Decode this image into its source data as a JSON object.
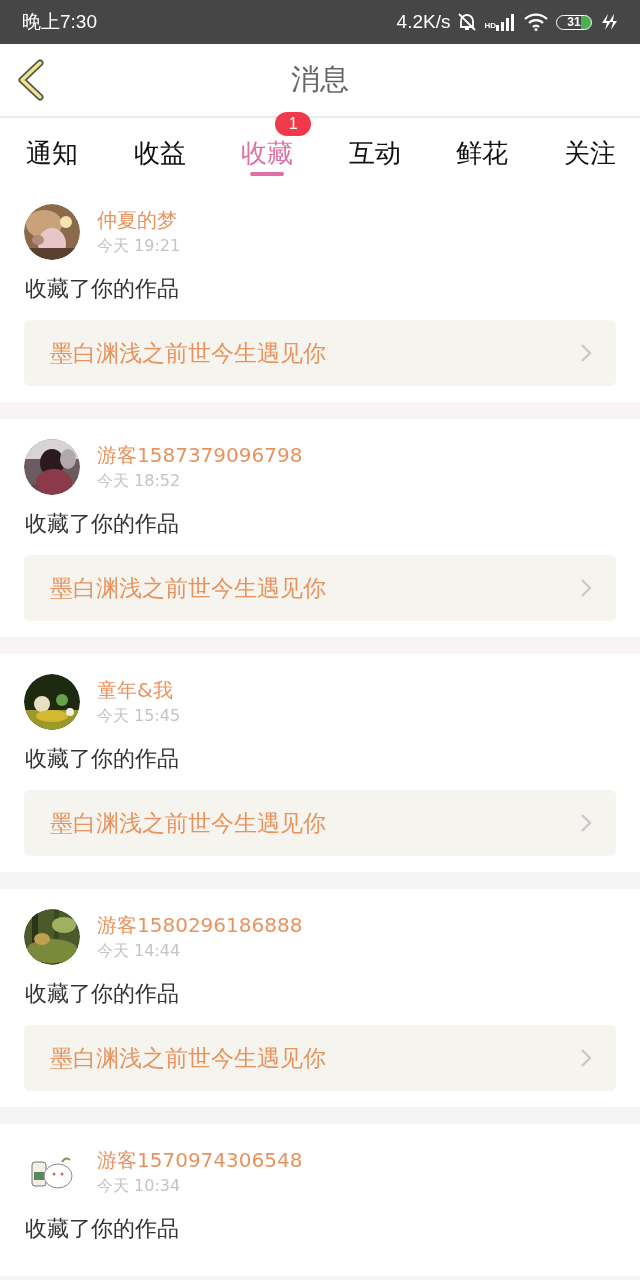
{
  "status_bar": {
    "time": "晚上7:30",
    "speed": "4.2K/s",
    "network": "HD",
    "battery": "31"
  },
  "header": {
    "title": "消息"
  },
  "tabs": [
    {
      "label": "通知",
      "selected": false
    },
    {
      "label": "收益",
      "selected": false
    },
    {
      "label": "收藏",
      "selected": true,
      "badge": "1"
    },
    {
      "label": "互动",
      "selected": false
    },
    {
      "label": "鲜花",
      "selected": false
    },
    {
      "label": "关注",
      "selected": false
    }
  ],
  "messages": [
    {
      "user": "仲夏的梦",
      "time": "今天 19:21",
      "text": "收藏了你的作品",
      "work": "墨白渊浅之前世今生遇见你"
    },
    {
      "user": "游客1587379096798",
      "time": "今天 18:52",
      "text": "收藏了你的作品",
      "work": "墨白渊浅之前世今生遇见你"
    },
    {
      "user": "童年&我",
      "time": "今天 15:45",
      "text": "收藏了你的作品",
      "work": "墨白渊浅之前世今生遇见你"
    },
    {
      "user": "游客1580296186888",
      "time": "今天 14:44",
      "text": "收藏了你的作品",
      "work": "墨白渊浅之前世今生遇见你"
    },
    {
      "user": "游客1570974306548",
      "time": "今天 10:34",
      "text": "收藏了你的作品"
    }
  ]
}
